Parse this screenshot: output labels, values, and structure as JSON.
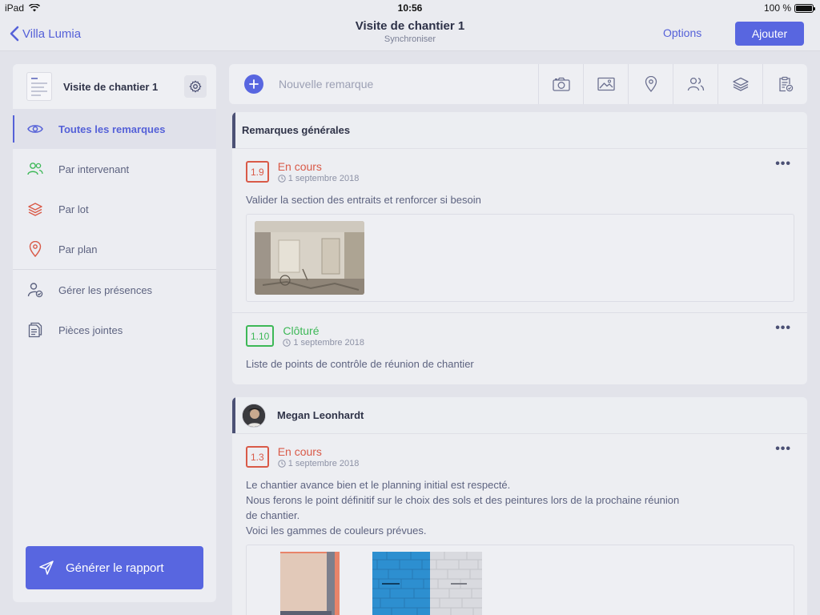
{
  "status_bar": {
    "device": "iPad",
    "time": "10:56",
    "battery": "100 %"
  },
  "navbar": {
    "back_label": "Villa Lumia",
    "title": "Visite de chantier 1",
    "subtitle": "Synchroniser",
    "options_label": "Options",
    "add_label": "Ajouter"
  },
  "sidebar": {
    "title": "Visite de chantier 1",
    "items": [
      {
        "label": "Toutes les remarques",
        "icon": "eye-icon"
      },
      {
        "label": "Par intervenant",
        "icon": "users-icon"
      },
      {
        "label": "Par lot",
        "icon": "layers-icon"
      },
      {
        "label": "Par plan",
        "icon": "map-pin-icon"
      },
      {
        "label": "Gérer les présences",
        "icon": "user-check-icon"
      },
      {
        "label": "Pièces jointes",
        "icon": "files-icon"
      }
    ],
    "report_label": "Générer le rapport"
  },
  "new_remark": {
    "placeholder": "Nouvelle remarque"
  },
  "groups": [
    {
      "title": "Remarques générales",
      "remarks": [
        {
          "number": "1.9",
          "status": "En cours",
          "date": "1 septembre 2018",
          "text": "Valider la section des entraits et renforcer si besoin"
        },
        {
          "number": "1.10",
          "status": "Clôturé",
          "date": "1 septembre 2018",
          "text": "Liste de points de contrôle de réunion de chantier"
        }
      ]
    },
    {
      "title": "Megan Leonhardt",
      "remarks": [
        {
          "number": "1.3",
          "status": "En cours",
          "date": "1 septembre 2018",
          "lines": [
            "Le chantier avance bien et le planning initial est respecté.",
            "Nous ferons le point définitif sur le choix des sols et des peintures lors de la prochaine réunion",
            "de chantier.",
            "Voici les gammes de couleurs prévues."
          ]
        }
      ]
    }
  ],
  "colors": {
    "accent": "#5866e0",
    "in_progress": "#d95a48",
    "closed": "#3db857"
  }
}
